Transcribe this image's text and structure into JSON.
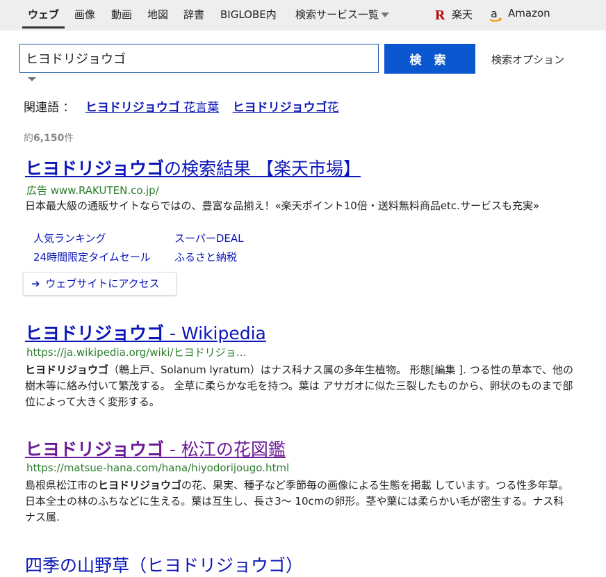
{
  "nav": {
    "items": [
      "ウェブ",
      "画像",
      "動画",
      "地図",
      "辞書",
      "BIGLOBE内"
    ],
    "services_label": "検索サービス一覧",
    "rakuten_label": "楽天",
    "amazon_label": "Amazon"
  },
  "search": {
    "query": "ヒヨドリジョウゴ",
    "button_label": "検 索",
    "options_label": "検索オプション"
  },
  "related": {
    "label": "関連語 ：",
    "links": [
      {
        "bold": "ヒヨドリジョウゴ",
        "rest": " 花言葉"
      },
      {
        "bold": "ヒヨドリジョウゴ",
        "rest": "花"
      }
    ]
  },
  "result_count": {
    "prefix": "約",
    "number": "6,150",
    "suffix": "件"
  },
  "ad": {
    "title_bold": "ヒヨドリジョウゴ",
    "title_rest": "の検索結果 【楽天市場】",
    "url": "広告 www.RAKUTEN.co.jp/",
    "description": "日本最大級の通販サイトならではの、豊富な品揃え！«楽天ポイント10倍・送料無料商品etc.サービスも充実»",
    "sitelinks": [
      "人気ランキング",
      "スーパーDEAL",
      "24時間限定タイムセール",
      "ふるさと納税"
    ],
    "visit_button": "ウェブサイトにアクセス"
  },
  "results": [
    {
      "title_bold": "ヒヨドリジョウゴ",
      "title_rest": " - Wikipedia",
      "url": "https://ja.wikipedia.org/wiki/ヒヨドリジョ…",
      "desc_bold": "ヒヨドリジョウゴ",
      "desc_rest": "（鵯上戸、Solanum lyratum）はナス科ナス属の多年生植物。 形態[編集 ]. つる性の草本で、他の樹木等に絡み付いて繁茂する。 全草に柔らかな毛を持つ。葉は アサガオに似た三裂したものから、卵状のものまで部位によって大きく変形する。"
    },
    {
      "title_bold": "ヒヨドリジョウゴ",
      "title_rest": " - 松江の花図鑑",
      "url": "https://matsue-hana.com/hana/hiyodorijougo.html",
      "desc_pre": "島根県松江市の",
      "desc_bold": "ヒヨドリジョウゴ",
      "desc_rest": "の花、果実、種子など季節毎の画像による生態を掲載 しています。つる性多年草。日本全土の林のふちなどに生える。葉は互生し、長さ3～ 10cmの卵形。茎や葉には柔らかい毛が密生する。ナス科ナス属."
    }
  ],
  "partial_title": "四季の山野草（ヒヨドリジョウゴ）",
  "colors": {
    "link": "#0b16b8",
    "visited": "#6b1a98",
    "url_green": "#2c7d2c",
    "button_blue": "#0b57d0",
    "topbar": "#eeeeee"
  }
}
